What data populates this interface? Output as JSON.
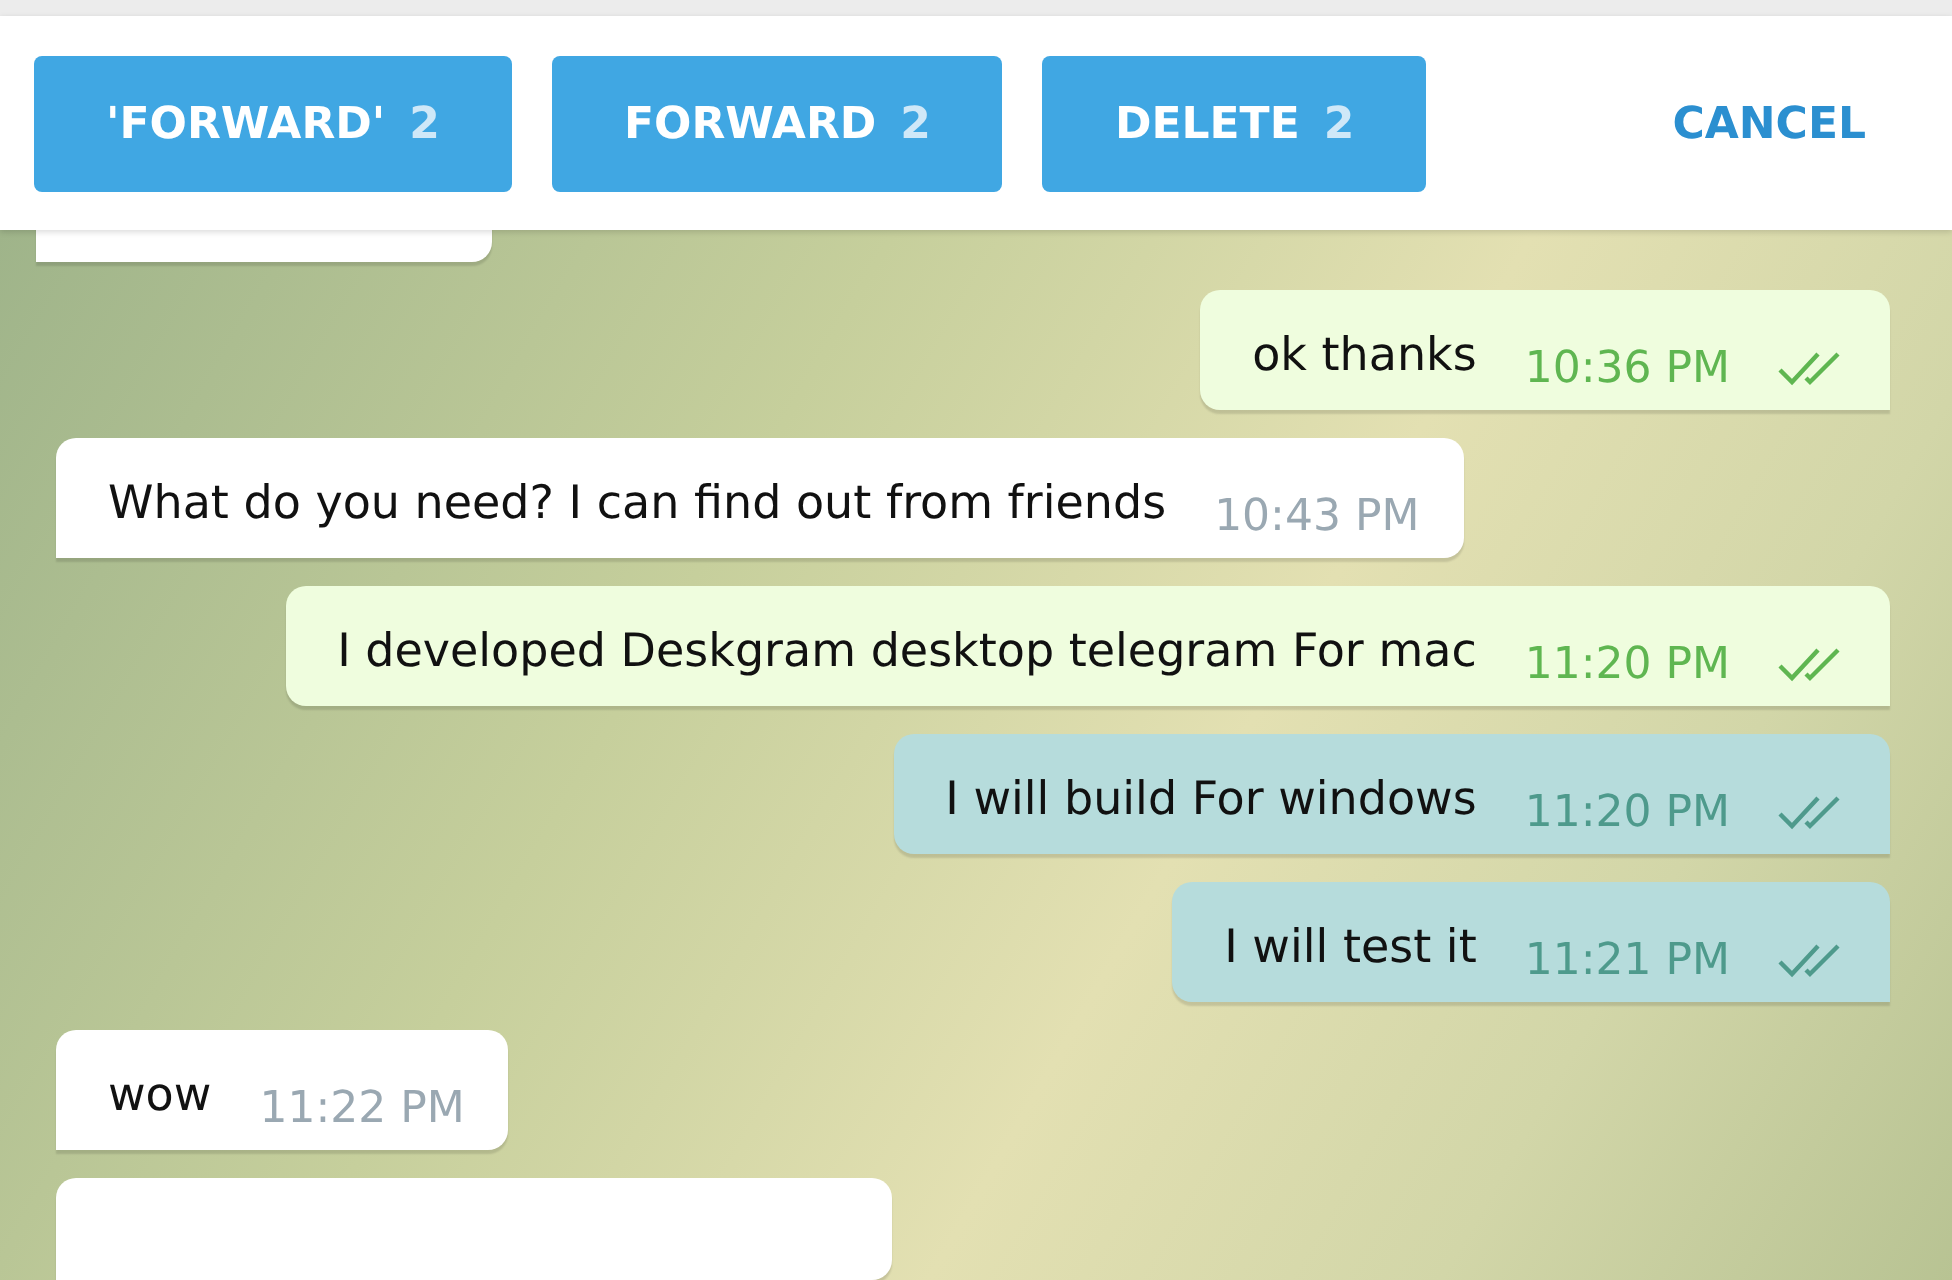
{
  "toolbar": {
    "buttons": [
      {
        "label": "'FORWARD'",
        "count": "2"
      },
      {
        "label": "FORWARD",
        "count": "2"
      },
      {
        "label": "DELETE",
        "count": "2"
      }
    ],
    "cancel": "CANCEL"
  },
  "messages": [
    {
      "kind": "in",
      "selected": false
    },
    {
      "kind": "out",
      "text": "ok thanks",
      "time": "10:36 PM",
      "selected": false,
      "read": true
    },
    {
      "kind": "in",
      "text": "What do you need? I can find out from friends",
      "time": "10:43 PM",
      "selected": false
    },
    {
      "kind": "out",
      "text": "I developed Deskgram desktop telegram For mac",
      "time": "11:20 PM",
      "selected": false,
      "read": true
    },
    {
      "kind": "out",
      "text": "I will build For windows",
      "time": "11:20 PM",
      "selected": true,
      "read": true
    },
    {
      "kind": "out",
      "text": "I will test it",
      "time": "11:21 PM",
      "selected": true,
      "read": true
    },
    {
      "kind": "in",
      "text": "wow",
      "time": "11:22 PM",
      "selected": false
    },
    {
      "kind": "in",
      "selected": false
    }
  ]
}
